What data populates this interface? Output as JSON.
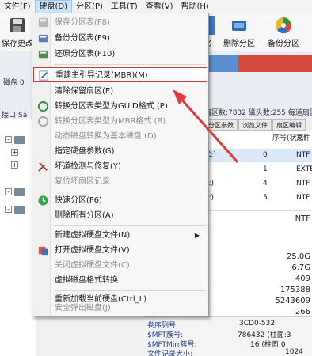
{
  "menubar": {
    "items": [
      "文件(F)",
      "硬盘(D)",
      "分区(P)",
      "工具(T)",
      "查看(V)",
      "帮助(H)"
    ]
  },
  "toolbar": {
    "save_label": "保存更改",
    "format_label": "化",
    "delete_label": "删除分区",
    "backup_label": "备份分区"
  },
  "disk": {
    "label": "磁盘 0",
    "port": "接口:Sa",
    "info": "扇区数:7832 磁头数:255 每道扇区数"
  },
  "table": {
    "tabs": [
      "分区参数",
      "浏览文件",
      "扇区编辑"
    ],
    "col_seq": "序号(状态)",
    "col_fs": "文件",
    "rows": [
      {
        "name": "C:)",
        "seq": "0",
        "fs": "NTF"
      },
      {
        "name": "",
        "seq": "1",
        "fs": "EXTE"
      },
      {
        "name": "(:)",
        "seq": "4",
        "fs": "NTF"
      },
      {
        "name": "(:)",
        "seq": "5",
        "fs": "NTF"
      }
    ]
  },
  "details": {
    "values": [
      "NTF",
      "25.0G",
      "6.7G",
      "409",
      "175388",
      "5243609",
      "266"
    ]
  },
  "footer": {
    "rows": [
      {
        "label": "卷序列号:",
        "value": "3CD0-532"
      },
      {
        "label": "$MFT簇号:",
        "value": "786432 (柱面:3"
      },
      {
        "label": "$MFTMirr簇号:",
        "value": "16 (柱面:0"
      },
      {
        "label": "文件记录大小:",
        "value": "1024"
      }
    ]
  },
  "dropdown": {
    "items": [
      {
        "label": "保存分区表(F8)",
        "disabled": true,
        "icon": "save-icon"
      },
      {
        "label": "备份分区表(F9)",
        "disabled": false,
        "icon": "backup-icon"
      },
      {
        "label": "还原分区表(F10)",
        "disabled": false,
        "icon": "restore-icon"
      },
      {
        "label": "重建主引导记录(MBR)(M)",
        "disabled": false,
        "icon": "rebuild-icon",
        "highlight": true
      },
      {
        "label": "清除保留扇区(E)",
        "disabled": false,
        "icon": ""
      },
      {
        "label": "转换分区表类型为GUID格式 (P)",
        "disabled": false,
        "icon": "convert-icon"
      },
      {
        "label": "转换分区表类型为MBR格式 (B)",
        "disabled": true,
        "icon": "convert-gray-icon"
      },
      {
        "label": "动态磁盘转换为基本磁盘 (D)",
        "disabled": true,
        "icon": ""
      },
      {
        "label": "指定硬盘参数(G)",
        "disabled": false,
        "icon": ""
      },
      {
        "label": "坏道检测与修复(Y)",
        "disabled": false,
        "icon": "repair-icon"
      },
      {
        "label": "复位坏扇区记录",
        "disabled": true,
        "icon": ""
      },
      {
        "label": "快速分区(F6)",
        "disabled": false,
        "icon": "quick-partition-icon"
      },
      {
        "label": "删除所有分区(A)",
        "disabled": false,
        "icon": ""
      },
      {
        "label": "新建虚拟硬盘文件(N)",
        "disabled": false,
        "icon": "",
        "submenu": true
      },
      {
        "label": "打开虚拟硬盘文件(V)",
        "disabled": false,
        "icon": "open-vdisk-icon"
      },
      {
        "label": "关闭虚拟硬盘文件(C)",
        "disabled": true,
        "icon": ""
      },
      {
        "label": "虚拟磁盘格式转换",
        "disabled": false,
        "icon": ""
      },
      {
        "label": "重新加载当前硬盘(Ctrl_L)",
        "disabled": false,
        "icon": ""
      },
      {
        "label": "安全弹出磁盘(J)",
        "disabled": true,
        "icon": ""
      }
    ]
  },
  "colors": {
    "highlight_border": "#d23b3b",
    "menu_active": "#cce4f7"
  }
}
